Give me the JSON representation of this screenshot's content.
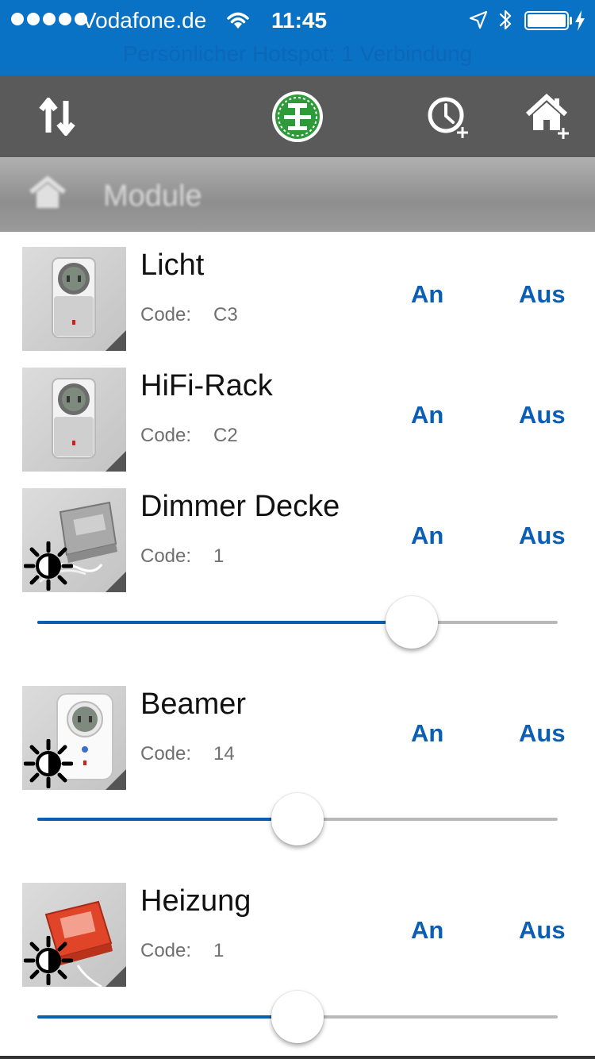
{
  "status_bar": {
    "carrier": "Vodafone.de",
    "time": "11:45",
    "hotspot": "Persönlicher Hotspot: 1 Verbindung",
    "signal_bars": 5,
    "battery_level": 1.0
  },
  "toolbar": {
    "sort_icon": "sort-arrows-icon",
    "logo_icon": "intertechno-logo",
    "timer_icon": "add-timer-icon",
    "room_icon": "add-room-icon"
  },
  "header": {
    "title": "Module",
    "icon": "home-icon"
  },
  "colors": {
    "status_bar": "#0a72c4",
    "toolbar": "#5a5a5a",
    "accent": "#0a5fb4",
    "logo_green": "#2e9a3a"
  },
  "modules": [
    {
      "name": "Licht",
      "code_label": "Code:",
      "code": "C3",
      "on_label": "An",
      "off_label": "Aus",
      "device_icon": "socket-switch-icon"
    },
    {
      "name": "HiFi-Rack",
      "code_label": "Code:",
      "code": "C2",
      "on_label": "An",
      "off_label": "Aus",
      "device_icon": "socket-switch-icon"
    },
    {
      "name": "Dimmer Decke",
      "code_label": "Code:",
      "code": "1",
      "on_label": "An",
      "off_label": "Aus",
      "device_icon": "dimmer-module-icon",
      "dimmer_level": 0.72
    },
    {
      "name": "Beamer",
      "code_label": "Code:",
      "code": "14",
      "on_label": "An",
      "off_label": "Aus",
      "device_icon": "dimmer-socket-icon",
      "dimmer_level": 0.5
    },
    {
      "name": "Heizung",
      "code_label": "Code:",
      "code": "1",
      "on_label": "An",
      "off_label": "Aus",
      "device_icon": "red-dimmer-module-icon",
      "dimmer_level": 0.5
    }
  ]
}
